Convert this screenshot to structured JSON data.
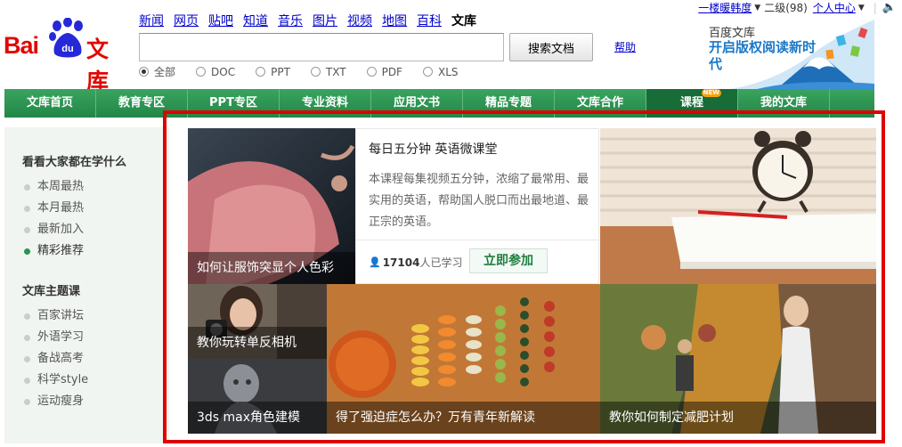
{
  "logo": {
    "bai": "Bai",
    "du": "du",
    "wenku": "文库"
  },
  "topnav": [
    "新闻",
    "网页",
    "贴吧",
    "知道",
    "音乐",
    "图片",
    "视频",
    "地图",
    "百科",
    "文库"
  ],
  "search": {
    "value": "",
    "button": "搜索文档",
    "help": "帮助"
  },
  "filetypes": [
    "全部",
    "DOC",
    "PPT",
    "TXT",
    "PDF",
    "XLS"
  ],
  "userbar": {
    "user": "一楼暖韩度",
    "level": "二级(98)",
    "center": "个人中心"
  },
  "promo": {
    "line1": "百度文库",
    "line2": "开启版权阅读新时代"
  },
  "mainnav": [
    "文库首页",
    "教育专区",
    "PPT专区",
    "专业资料",
    "应用文书",
    "精品专题",
    "文库合作",
    "课程",
    "我的文库"
  ],
  "mainnav_badge": "NEW",
  "sidebar": {
    "heading1": "看看大家都在学什么",
    "items1": [
      "本周最热",
      "本月最热",
      "最新加入",
      "精彩推荐"
    ],
    "heading2": "文库主题课",
    "items2": [
      "百家讲坛",
      "外语学习",
      "备战高考",
      "科学style",
      "运动瘦身"
    ]
  },
  "course": {
    "title": "每日五分钟 英语微课堂",
    "desc": "本课程每集视频五分钟，浓缩了最常用、最实用的英语，帮助国人脱口而出最地道、最正宗的英语。",
    "count": "17104",
    "count_suffix": "人已学习",
    "join": "立即参加"
  },
  "tiles": {
    "dress": "如何让服饰突显个人色彩",
    "camera": "教你玩转单反相机",
    "max": "3ds max角色建模",
    "ocd": "得了强迫症怎么办？万有青年新解读",
    "fitness": "教你如何制定减肥计划"
  },
  "colors": {
    "nav_green": "#2a9650",
    "brand_red": "#e10601",
    "highlight": "#e00000"
  }
}
